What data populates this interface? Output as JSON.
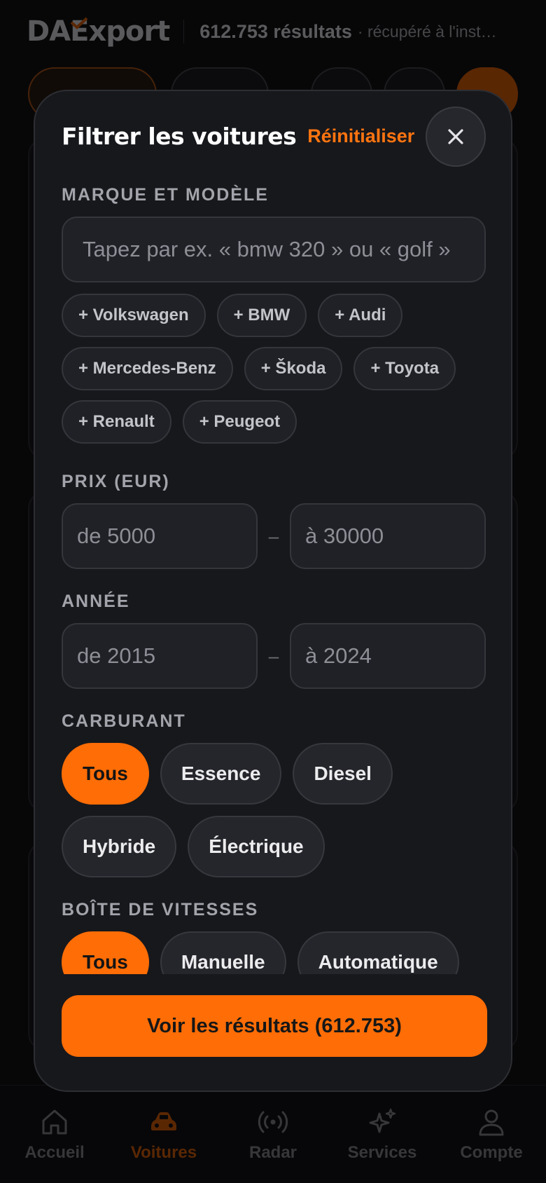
{
  "header": {
    "logo_text": "DAExport",
    "results_count": "612.753 résultats",
    "results_meta": "· récupéré à l'inst…"
  },
  "bottom_nav": [
    {
      "label": "Accueil",
      "icon": "home-icon",
      "active": false
    },
    {
      "label": "Voitures",
      "icon": "car-icon",
      "active": true
    },
    {
      "label": "Radar",
      "icon": "radar-icon",
      "active": false
    },
    {
      "label": "Services",
      "icon": "sparkles-icon",
      "active": false
    },
    {
      "label": "Compte",
      "icon": "user-icon",
      "active": false
    }
  ],
  "modal": {
    "title": "Filtrer les voitures",
    "reset_label": "Réinitialiser",
    "close_icon": "close-icon",
    "make_model": {
      "label": "Marque et modèle",
      "placeholder": "Tapez par ex. « bmw 320 » ou « golf »",
      "quick_makes": [
        "+ Volkswagen",
        "+ BMW",
        "+ Audi",
        "+ Mercedes-Benz",
        "+ Škoda",
        "+ Toyota",
        "+ Renault",
        "+ Peugeot"
      ]
    },
    "price": {
      "label": "Prix (EUR)",
      "from_placeholder": "de 5000",
      "to_placeholder": "à 30000",
      "dash": "–"
    },
    "year": {
      "label": "Année",
      "from_placeholder": "de 2015",
      "to_placeholder": "à 2024",
      "dash": "–"
    },
    "fuel": {
      "label": "Carburant",
      "options": [
        "Tous",
        "Essence",
        "Diesel",
        "Hybride",
        "Électrique"
      ],
      "selected": "Tous"
    },
    "gearbox": {
      "label": "Boîte de vitesses",
      "options": [
        "Tous",
        "Manuelle",
        "Automatique"
      ],
      "selected": "Tous"
    },
    "cta_label": "Voir les résultats (612.753)"
  },
  "colors": {
    "accent": "#ff6d06",
    "modal_bg": "#17181c",
    "page_bg": "#0b0b0d"
  }
}
